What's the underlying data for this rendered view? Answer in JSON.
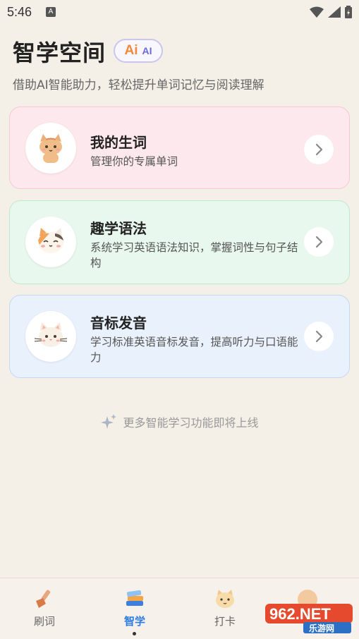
{
  "status_bar": {
    "time": "5:46",
    "notification_icon": "A"
  },
  "header": {
    "title": "智学空间",
    "badge_big": "Ai",
    "badge_small": "AI",
    "subtitle": "借助AI智能助力，轻松提升单词记忆与阅读理解"
  },
  "cards": [
    {
      "title": "我的生词",
      "desc": "管理你的专属单词",
      "icon": "cat-icon",
      "color": "#fde8ed"
    },
    {
      "title": "趣学语法",
      "desc": "系统学习英语语法知识，掌握词性与句子结构",
      "icon": "calico-cat-icon",
      "color": "#e8f8ee"
    },
    {
      "title": "音标发音",
      "desc": "学习标准英语音标发音，提高听力与口语能力",
      "icon": "white-cat-icon",
      "color": "#e9f1fc"
    }
  ],
  "more_text": "更多智能学习功能即将上线",
  "nav": [
    {
      "label": "刷词",
      "icon": "broom-icon"
    },
    {
      "label": "智学",
      "icon": "books-icon",
      "active": true
    },
    {
      "label": "打卡",
      "icon": "cat-check-icon"
    }
  ],
  "watermark": {
    "brand": "962.NET",
    "sub": "乐游网"
  }
}
